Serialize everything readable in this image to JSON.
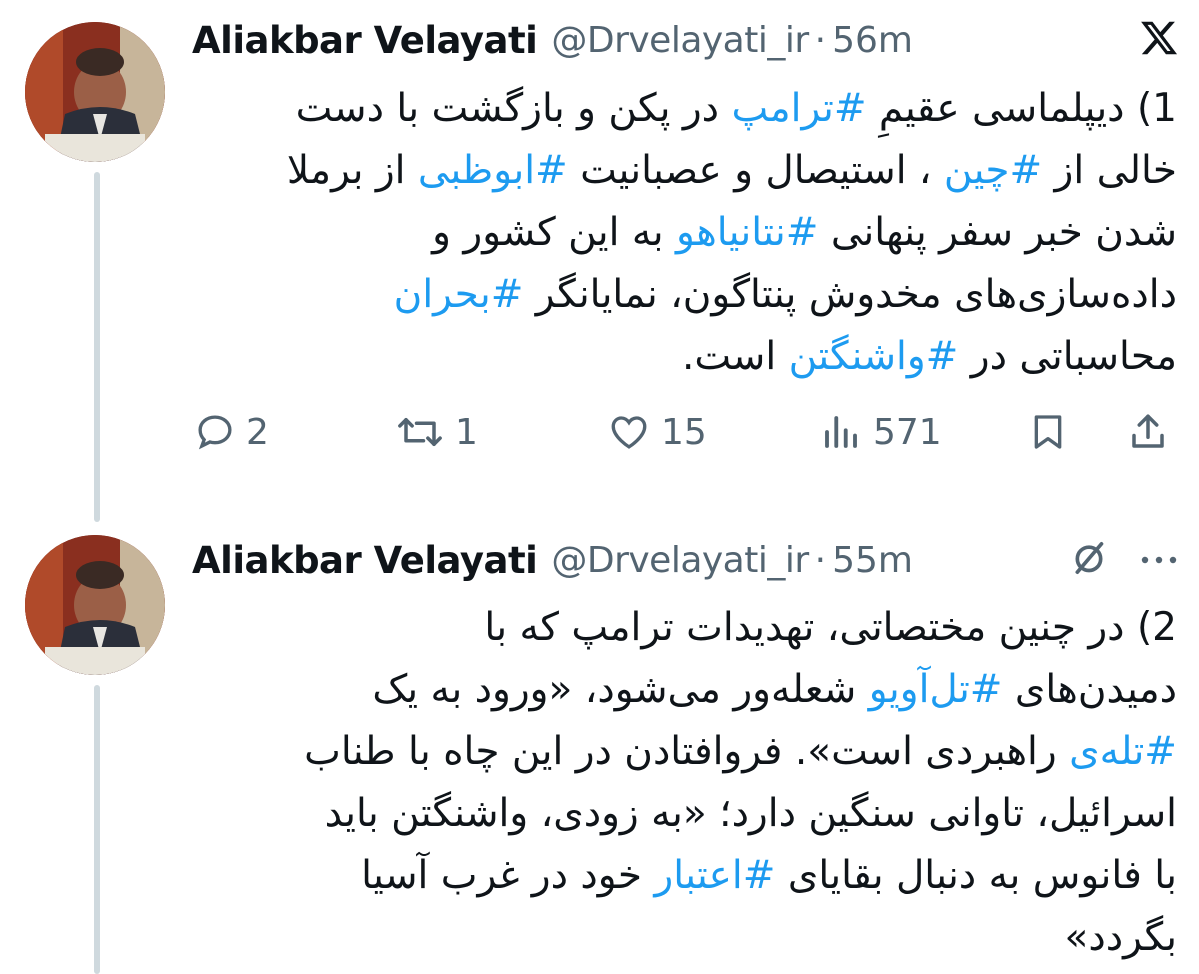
{
  "tweets": [
    {
      "author": "Aliakbar Velayati",
      "handle": "@Drvelayati_ir",
      "separator": "·",
      "time": "56m",
      "lines": [
        [
          {
            "t": "1) دیپلماسی عقیمِ "
          },
          {
            "t": "#ترامپ",
            "tag": true
          },
          {
            "t": " در پکن و بازگشت با دست"
          }
        ],
        [
          {
            "t": "خالی از "
          },
          {
            "t": "#چین",
            "tag": true
          },
          {
            "t": " ، استیصال و عصبانیت  "
          },
          {
            "t": "#ابوظبی",
            "tag": true
          },
          {
            "t": " از برملا"
          }
        ],
        [
          {
            "t": "شدن خبر سفر پنهانی "
          },
          {
            "t": "#نتانیاهو",
            "tag": true
          },
          {
            "t": " به این کشور و"
          }
        ],
        [
          {
            "t": "داده‌سازی‌های مخدوش پنتاگون، نمایانگر "
          },
          {
            "t": "#بحران",
            "tag": true
          }
        ],
        [
          {
            "t": "محاسباتی در "
          },
          {
            "t": "#واشنگتن",
            "tag": true
          },
          {
            "t": " است."
          }
        ]
      ],
      "actions": {
        "replies": "2",
        "reposts": "1",
        "likes": "15",
        "views": "571"
      }
    },
    {
      "author": "Aliakbar Velayati",
      "handle": "@Drvelayati_ir",
      "separator": "·",
      "time": "55m",
      "lines": [
        [
          {
            "t": "2) در چنین مختصاتی، تهدیدات ترامپ که با"
          }
        ],
        [
          {
            "t": "دمیدن‌های "
          },
          {
            "t": "#تل‌آویو",
            "tag": true
          },
          {
            "t": " شعله‌ور می‌شود، «ورود به یک"
          }
        ],
        [
          {
            "t": "#تله‌ی",
            "tag": true
          },
          {
            "t": " راهبردی است». فروافتادن در این چاه با طناب"
          }
        ],
        [
          {
            "t": "اسرائیل، تاوانی سنگین دارد؛ «به زودی، واشنگتن باید"
          }
        ],
        [
          {
            "t": "با فانوس به دنبال بقایای "
          },
          {
            "t": "#اعتبار",
            "tag": true
          },
          {
            "t": " خود در غرب آسیا"
          }
        ],
        [
          {
            "t": "بگردد»"
          }
        ]
      ]
    }
  ],
  "icons": {
    "logo": "x-logo-icon",
    "reply": "speech-bubble-icon",
    "repost": "repost-arrows-icon",
    "like": "heart-icon",
    "views": "bar-chart-icon",
    "bookmark": "bookmark-icon",
    "share": "share-upload-icon",
    "grok": "grok-slash-circle-icon",
    "more": "more-dots-icon"
  },
  "colors": {
    "hashtag": "#1d9bf0",
    "muted": "#536471",
    "text": "#0f1419",
    "thread_line": "#cfd9de"
  }
}
